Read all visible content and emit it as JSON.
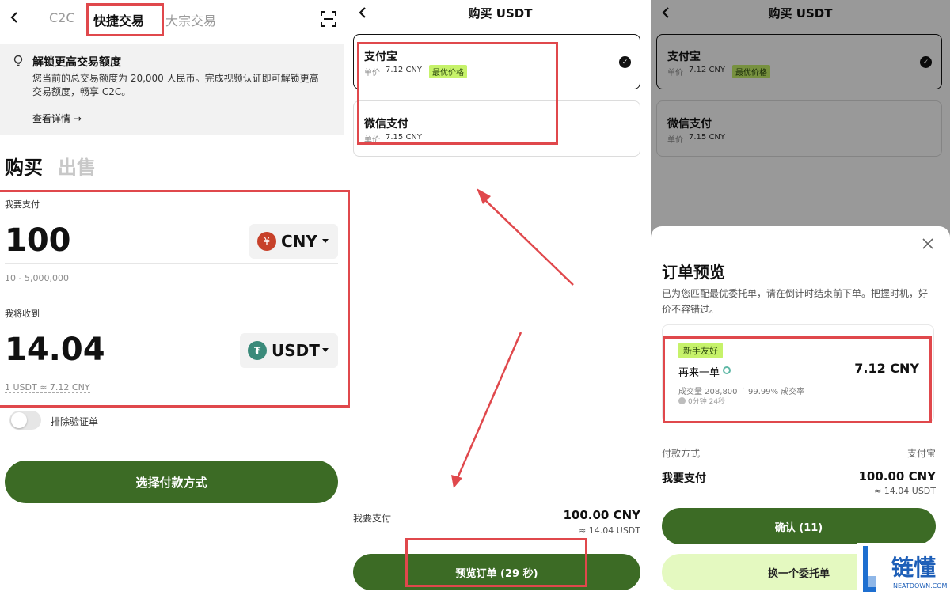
{
  "panel1": {
    "tabs": {
      "c2c": "C2C",
      "express": "快捷交易",
      "bulk": "大宗交易"
    },
    "banner": {
      "title": "解锁更高交易额度",
      "text_line1": "您当前的总交易额度为 20,000 人民币。完成视频认证即可解锁更高",
      "text_line2": "交易额度，畅享 C2C。",
      "link": "查看详情 →"
    },
    "side": {
      "buy": "购买",
      "sell": "出售"
    },
    "pay": {
      "label": "我要支付",
      "amount": "100",
      "currency": "CNY",
      "currency_symbol": "¥",
      "range": "10 - 5,000,000"
    },
    "receive": {
      "label": "我将收到",
      "amount": "14.04",
      "currency": "USDT",
      "rate": "1 USDT ≈ 7.12 CNY"
    },
    "toggle_label": "排除验证单",
    "cta": "选择付款方式"
  },
  "panel2": {
    "title": "购买 USDT",
    "methods": [
      {
        "name": "支付宝",
        "price_label": "单价",
        "price": "7.12 CNY",
        "tag": "最优价格"
      },
      {
        "name": "微信支付",
        "price_label": "单价",
        "price": "7.15 CNY"
      }
    ],
    "pay_label": "我要支付",
    "pay_amount": "100.00 CNY",
    "pay_approx": "≈ 14.04 USDT",
    "cta": "预览订单 (29 秒)"
  },
  "panel3": {
    "title": "购买 USDT",
    "methods": [
      {
        "name": "支付宝",
        "price_label": "单价",
        "price": "7.12 CNY",
        "tag": "最优价格"
      },
      {
        "name": "微信支付",
        "price_label": "单价",
        "price": "7.15 CNY"
      }
    ],
    "sheet": {
      "title": "订单预览",
      "desc_line1": "已为您匹配最优委托单，请在倒计时结束前下单。把握时机，好",
      "desc_line2": "价不容错过。",
      "tag": "新手友好",
      "merchant": "再来一单",
      "price": "7.12 CNY",
      "stats_volume": "成交量 208,800",
      "stats_rate": "99.99% 成交率",
      "time": "0分钟 24秒",
      "method_label": "付款方式",
      "method_value": "支付宝",
      "pay_label": "我要支付",
      "pay_amount": "100.00 CNY",
      "pay_approx": "≈ 14.04 USDT",
      "confirm": "确认 (11)",
      "switch": "换一个委托单"
    }
  },
  "watermark": {
    "brand": "链懂",
    "domain": "NEATDOWN.COM"
  },
  "colors": {
    "accent_green": "#3c6b25",
    "tag_green": "#c6f26a",
    "annotation_red": "#e0484c",
    "switch_bg": "#e4f9c0"
  }
}
